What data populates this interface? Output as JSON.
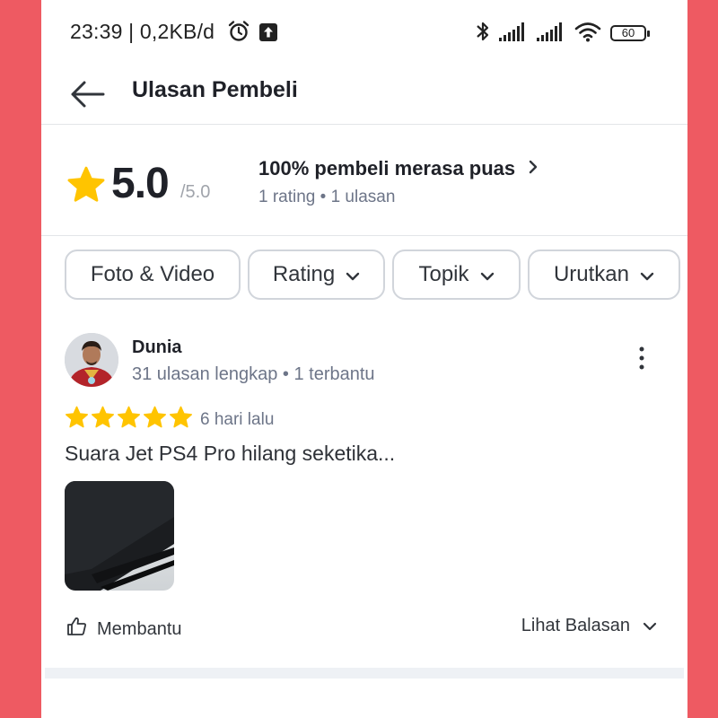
{
  "status_bar": {
    "time": "23:39 | 0,2KB/d",
    "battery": "60",
    "icons": [
      "alarm-icon",
      "upload-notification-icon",
      "bluetooth-icon",
      "signal-icon",
      "signal-icon",
      "wifi-icon",
      "battery-icon"
    ]
  },
  "header": {
    "back_icon": "arrow-left-icon",
    "title": "Ulasan Pembeli"
  },
  "summary": {
    "score": "5.0",
    "score_max": "/5.0",
    "satisfaction": "100% pembeli merasa puas",
    "counts": "1 rating • 1 ulasan"
  },
  "filters": [
    {
      "label": "Foto & Video",
      "has_dropdown": false
    },
    {
      "label": "Rating",
      "has_dropdown": true
    },
    {
      "label": "Topik",
      "has_dropdown": true
    },
    {
      "label": "Urutkan",
      "has_dropdown": true
    }
  ],
  "review": {
    "name": "Dunia",
    "meta": "31 ulasan lengkap • 1 terbantu",
    "stars": 5,
    "time_ago": "6 hari lalu",
    "text": "Suara Jet PS4 Pro hilang seketika...",
    "helpful_label": "Membantu",
    "replies_label": "Lihat Balasan"
  },
  "colors": {
    "background": "#ee5a62",
    "star": "#ffc400",
    "text_primary": "#1f2128",
    "text_secondary": "#6d7588"
  }
}
